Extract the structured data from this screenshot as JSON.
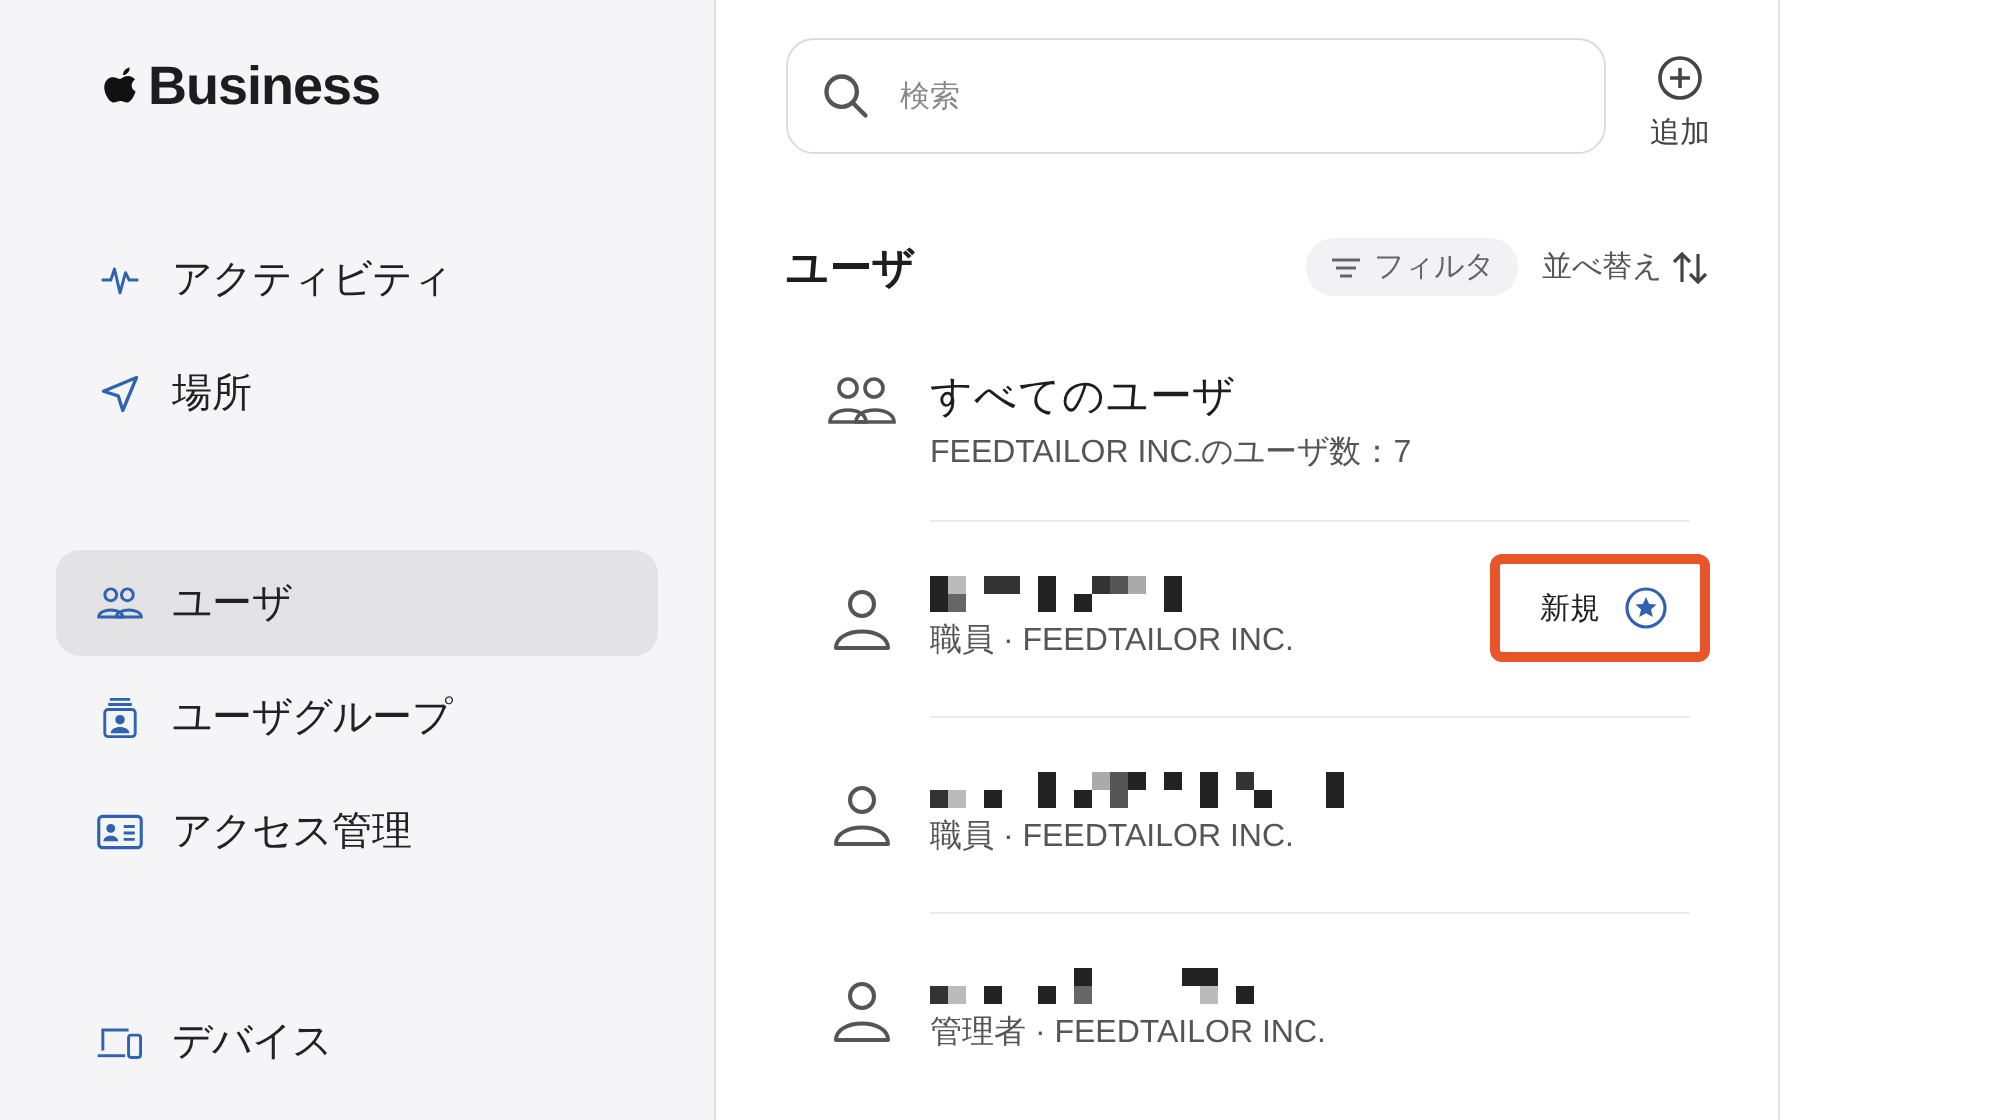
{
  "sidebar": {
    "logo": "Business",
    "groups": [
      [
        {
          "label": "アクティビティ",
          "kind": "activity",
          "selected": false
        },
        {
          "label": "場所",
          "kind": "location",
          "selected": false
        }
      ],
      [
        {
          "label": "ユーザ",
          "kind": "users",
          "selected": true
        },
        {
          "label": "ユーザグループ",
          "kind": "group",
          "selected": false
        },
        {
          "label": "アクセス管理",
          "kind": "idcard",
          "selected": false
        }
      ],
      [
        {
          "label": "デバイス",
          "kind": "devices",
          "selected": false
        }
      ]
    ]
  },
  "search": {
    "placeholder": "検索"
  },
  "add_button": {
    "label": "追加"
  },
  "users_header": {
    "title": "ユーザ",
    "filter": "フィルタ",
    "sort": "並べ替え"
  },
  "users": [
    {
      "kind": "all",
      "title": "すべてのユーザ",
      "subtitle": "FEEDTAILOR INC.のユーザ数：7"
    },
    {
      "kind": "person",
      "subtitle": "職員 · FEEDTAILOR INC.",
      "badge": {
        "label": "新規",
        "highlighted": true
      }
    },
    {
      "kind": "person",
      "subtitle": "職員 · FEEDTAILOR INC."
    },
    {
      "kind": "person",
      "subtitle": "管理者 · FEEDTAILOR INC."
    }
  ]
}
